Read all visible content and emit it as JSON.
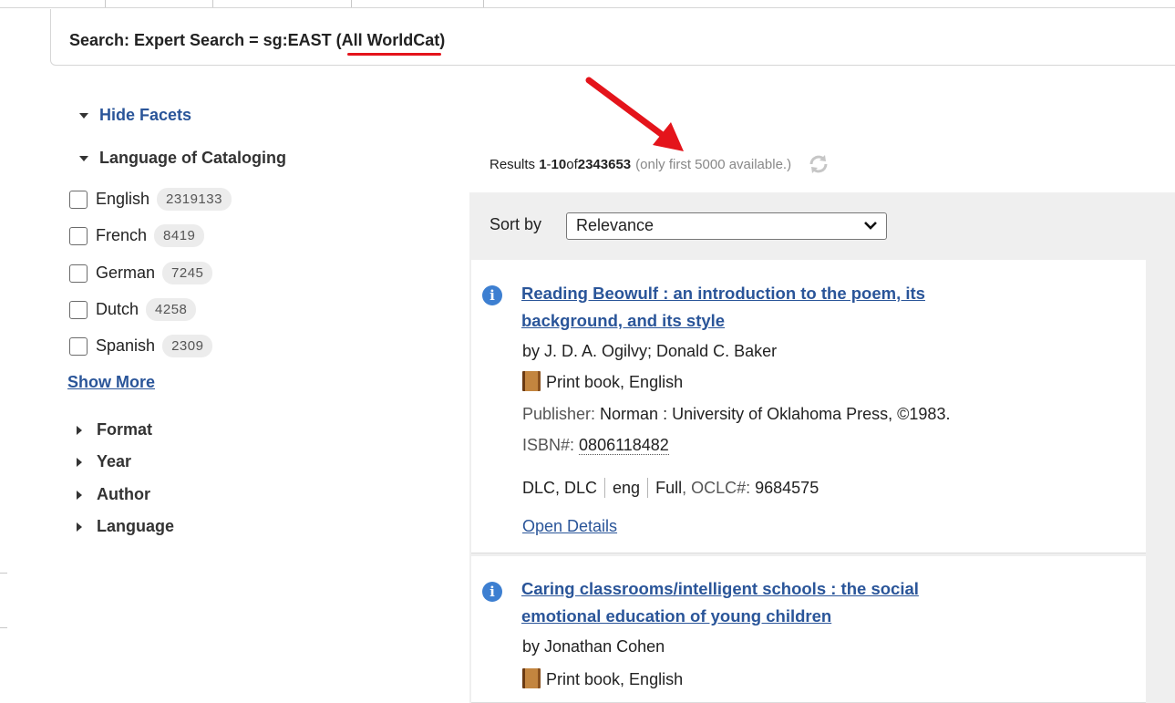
{
  "search": {
    "prefix": "Search: Expert Search = ",
    "query": "sg:EAST",
    "scope": " (All WorldCat)"
  },
  "facets": {
    "hide_label": "Hide Facets",
    "language_of_cataloging": {
      "heading": "Language of Cataloging",
      "items": [
        {
          "name": "English",
          "count": "2319133"
        },
        {
          "name": "French",
          "count": "8419"
        },
        {
          "name": "German",
          "count": "7245"
        },
        {
          "name": "Dutch",
          "count": "4258"
        },
        {
          "name": "Spanish",
          "count": "2309"
        }
      ],
      "show_more": "Show More"
    },
    "collapsed": [
      "Format",
      "Year",
      "Author",
      "Language"
    ]
  },
  "results": {
    "prefix": "Results ",
    "start": "1",
    "dash": " - ",
    "end": "10",
    "of": " of ",
    "total": "2343653",
    "note": "(only first 5000 available.)"
  },
  "sort": {
    "label": "Sort by",
    "selected": "Relevance"
  },
  "records": [
    {
      "title_line1": "Reading Beowulf : an introduction to the poem, its",
      "title_line2": "background, and its style",
      "authors": "by J. D. A. Ogilvy; Donald C. Baker",
      "format": "Print book, English",
      "publisher_label": "Publisher:",
      "publisher": " Norman : University of Oklahoma Press, ©1983.",
      "isbn_label": "ISBN#:",
      "isbn": "0806118482",
      "source": "DLC, DLC",
      "lang": "eng",
      "level": "Full",
      "oclc_label": ", OCLC#:",
      "oclc": " 9684575",
      "open_details": "Open Details"
    },
    {
      "title_line1": "Caring classrooms/intelligent schools : the social",
      "title_line2": "emotional education of young children",
      "authors": "by Jonathan Cohen",
      "format": "Print book, English"
    }
  ],
  "annotations": {
    "accent_color": "#e4141b"
  },
  "colors": {
    "link": "#2a5599",
    "info_icon": "#3d7fd1",
    "panel_bg": "#efefef"
  },
  "icons": {
    "info": "info-icon",
    "refresh": "refresh-icon",
    "book": "book-icon",
    "chevron": "chevron-down-icon"
  }
}
